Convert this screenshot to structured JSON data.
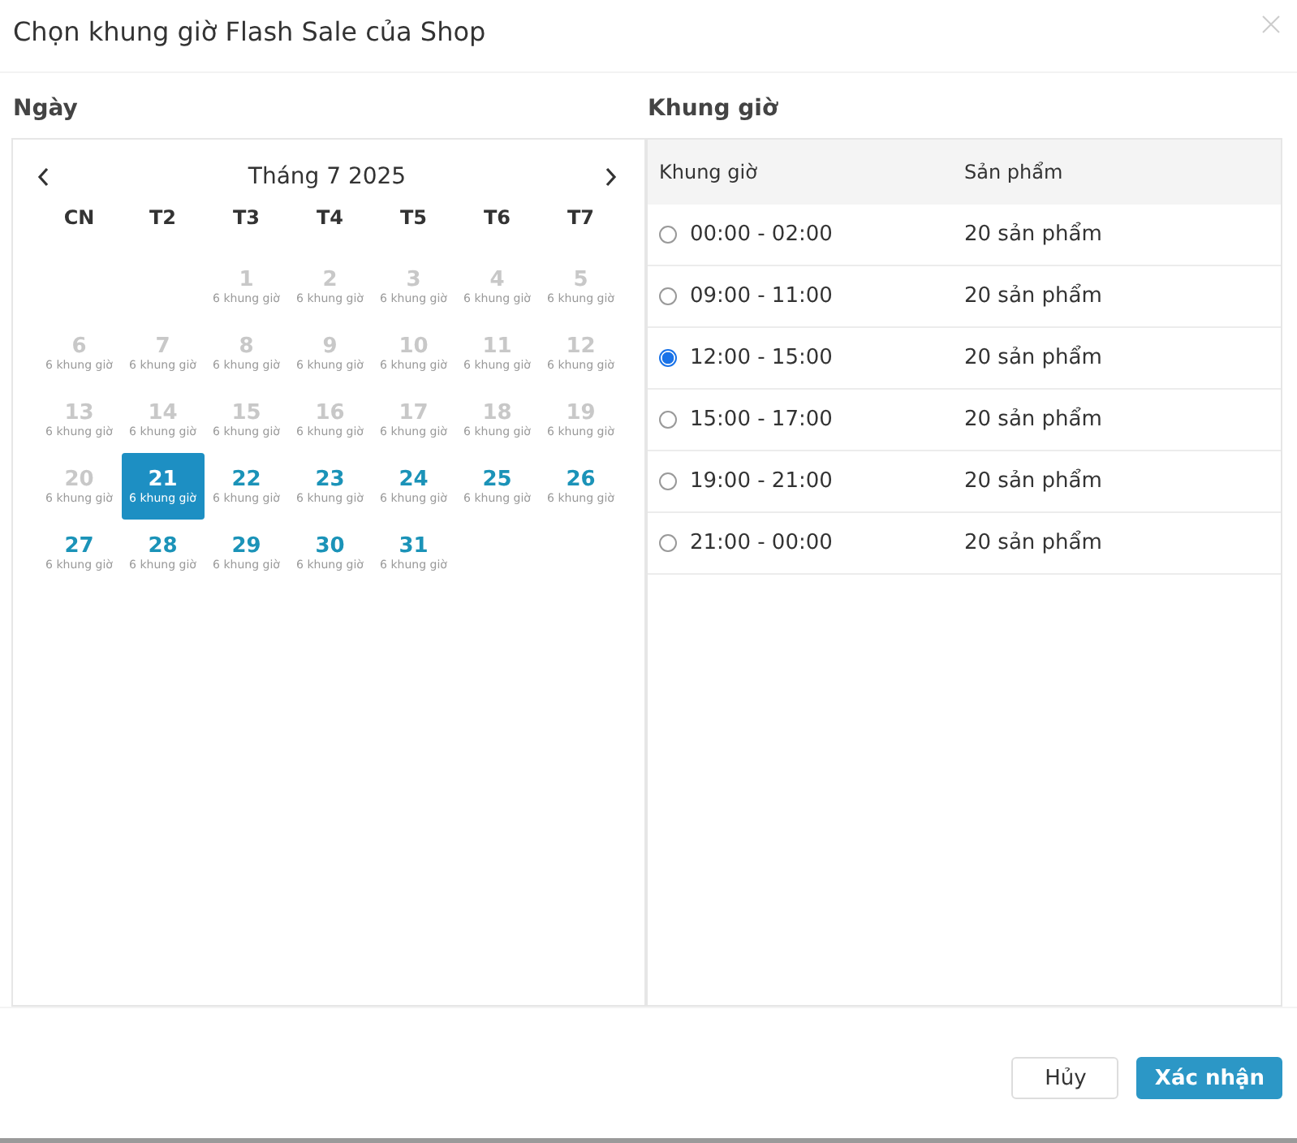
{
  "dialog": {
    "title": "Chọn khung giờ Flash Sale của Shop"
  },
  "date_panel": {
    "label": "Ngày",
    "month": "Tháng 7 2025",
    "weekdays": [
      "CN",
      "T2",
      "T3",
      "T4",
      "T5",
      "T6",
      "T7"
    ],
    "weeks": [
      [
        {
          "day": "1",
          "slots": "6 khung giờ",
          "disabled": true,
          "selected": false
        },
        {
          "day": "2",
          "slots": "6 khung giờ",
          "disabled": true,
          "selected": false
        },
        {
          "day": "3",
          "slots": "6 khung giờ",
          "disabled": true,
          "selected": false
        },
        {
          "day": "4",
          "slots": "6 khung giờ",
          "disabled": true,
          "selected": false
        },
        {
          "day": "5",
          "slots": "6 khung giờ",
          "disabled": true,
          "selected": false
        }
      ],
      [
        {
          "day": "6",
          "slots": "6 khung giờ",
          "disabled": true,
          "selected": false
        },
        {
          "day": "7",
          "slots": "6 khung giờ",
          "disabled": true,
          "selected": false
        },
        {
          "day": "8",
          "slots": "6 khung giờ",
          "disabled": true,
          "selected": false
        },
        {
          "day": "9",
          "slots": "6 khung giờ",
          "disabled": true,
          "selected": false
        },
        {
          "day": "10",
          "slots": "6 khung giờ",
          "disabled": true,
          "selected": false
        },
        {
          "day": "11",
          "slots": "6 khung giờ",
          "disabled": true,
          "selected": false
        },
        {
          "day": "12",
          "slots": "6 khung giờ",
          "disabled": true,
          "selected": false
        }
      ],
      [
        {
          "day": "13",
          "slots": "6 khung giờ",
          "disabled": true,
          "selected": false
        },
        {
          "day": "14",
          "slots": "6 khung giờ",
          "disabled": true,
          "selected": false
        },
        {
          "day": "15",
          "slots": "6 khung giờ",
          "disabled": true,
          "selected": false
        },
        {
          "day": "16",
          "slots": "6 khung giờ",
          "disabled": true,
          "selected": false
        },
        {
          "day": "17",
          "slots": "6 khung giờ",
          "disabled": true,
          "selected": false
        },
        {
          "day": "18",
          "slots": "6 khung giờ",
          "disabled": true,
          "selected": false
        },
        {
          "day": "19",
          "slots": "6 khung giờ",
          "disabled": true,
          "selected": false
        }
      ],
      [
        {
          "day": "20",
          "slots": "6 khung giờ",
          "disabled": true,
          "selected": false
        },
        {
          "day": "21",
          "slots": "6 khung giờ",
          "disabled": false,
          "selected": true
        },
        {
          "day": "22",
          "slots": "6 khung giờ",
          "disabled": false,
          "selected": false
        },
        {
          "day": "23",
          "slots": "6 khung giờ",
          "disabled": false,
          "selected": false
        },
        {
          "day": "24",
          "slots": "6 khung giờ",
          "disabled": false,
          "selected": false
        },
        {
          "day": "25",
          "slots": "6 khung giờ",
          "disabled": false,
          "selected": false
        },
        {
          "day": "26",
          "slots": "6 khung giờ",
          "disabled": false,
          "selected": false
        }
      ],
      [
        {
          "day": "27",
          "slots": "6 khung giờ",
          "disabled": false,
          "selected": false
        },
        {
          "day": "28",
          "slots": "6 khung giờ",
          "disabled": false,
          "selected": false
        },
        {
          "day": "29",
          "slots": "6 khung giờ",
          "disabled": false,
          "selected": false
        },
        {
          "day": "30",
          "slots": "6 khung giờ",
          "disabled": false,
          "selected": false
        },
        {
          "day": "31",
          "slots": "6 khung giờ",
          "disabled": false,
          "selected": false
        }
      ]
    ]
  },
  "slot_panel": {
    "label": "Khung giờ",
    "columns": [
      "Khung giờ",
      "Sản phẩm"
    ],
    "rows": [
      {
        "time": "00:00 - 02:00",
        "products": "20 sản phẩm",
        "selected": false
      },
      {
        "time": "09:00 - 11:00",
        "products": "20 sản phẩm",
        "selected": false
      },
      {
        "time": "12:00 - 15:00",
        "products": "20 sản phẩm",
        "selected": true
      },
      {
        "time": "15:00 - 17:00",
        "products": "20 sản phẩm",
        "selected": false
      },
      {
        "time": "19:00 - 21:00",
        "products": "20 sản phẩm",
        "selected": false
      },
      {
        "time": "21:00 - 00:00",
        "products": "20 sản phẩm",
        "selected": false
      }
    ]
  },
  "buttons": [
    {
      "label": "Hủy",
      "kind": "secondary"
    },
    {
      "label": "Xác nhận",
      "kind": "primary"
    }
  ]
}
